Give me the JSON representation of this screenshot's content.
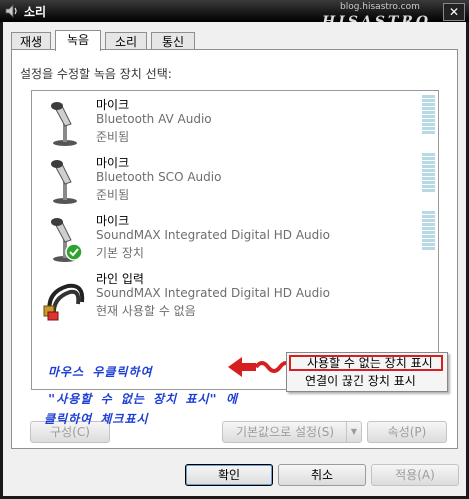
{
  "window": {
    "title": "소리",
    "close_label": "✕"
  },
  "watermark": {
    "url": "blog.hisastro.com",
    "brand": "HISASTRO"
  },
  "tabs": [
    {
      "label": "재생",
      "active": false
    },
    {
      "label": "녹음",
      "active": true
    },
    {
      "label": "소리",
      "active": false
    },
    {
      "label": "통신",
      "active": false
    }
  ],
  "panel": {
    "instruction": "설정을 수정할 녹음 장치 선택:"
  },
  "devices": [
    {
      "name": "마이크",
      "description": "Bluetooth AV Audio",
      "status": "준비됨",
      "icon": "microphone-icon",
      "default": false
    },
    {
      "name": "마이크",
      "description": "Bluetooth SCO Audio",
      "status": "준비됨",
      "icon": "microphone-icon",
      "default": false
    },
    {
      "name": "마이크",
      "description": "SoundMAX Integrated Digital HD Audio",
      "status": "기본 장치",
      "icon": "microphone-icon",
      "default": true
    },
    {
      "name": "라인 입력",
      "description": "SoundMAX Integrated Digital HD Audio",
      "status": "현재 사용할 수 없음",
      "icon": "rca-cable-icon",
      "default": false
    }
  ],
  "context_menu": {
    "items": [
      {
        "label": "사용할 수 없는 장치 표시",
        "highlighted": true
      },
      {
        "label": "연결이 끊긴 장치 표시",
        "highlighted": false
      }
    ]
  },
  "annotation": {
    "line1": "마우스 우클릭하여",
    "line2": "\"사용할 수 없는 장치 표시\" 에",
    "line3": "클릭하여 체크표시",
    "color": "#1e3fd6",
    "arrow_color": "#d62020"
  },
  "panel_buttons": {
    "configure": "구성(C)",
    "set_default": "기본값으로 설정(S)",
    "properties": "속성(P)"
  },
  "dialog_buttons": {
    "ok": "확인",
    "cancel": "취소",
    "apply": "적용(A)"
  }
}
